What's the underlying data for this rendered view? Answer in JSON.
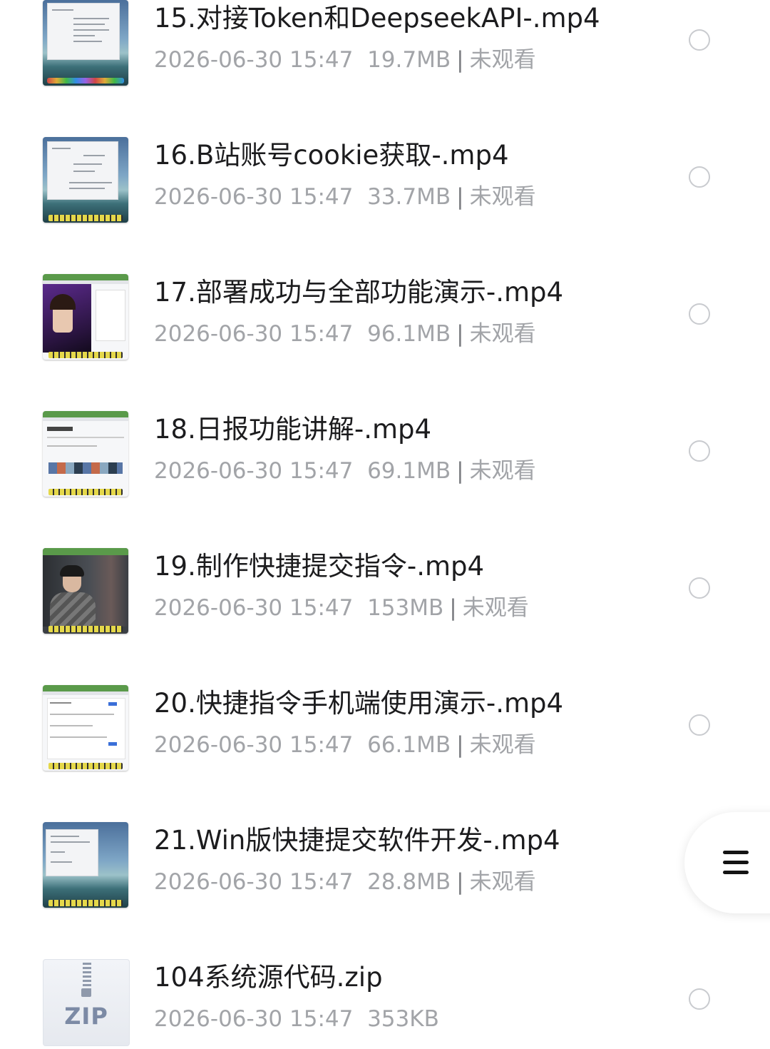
{
  "files": [
    {
      "name": "15.对接Token和DeepseekAPI-.mp4",
      "date": "2026-06-30 15:47",
      "size": "19.7MB",
      "status": "未观看",
      "thumb_icon": "video-thumbnail-icon"
    },
    {
      "name": "16.B站账号cookie获取-.mp4",
      "date": "2026-06-30 15:47",
      "size": "33.7MB",
      "status": "未观看",
      "thumb_icon": "video-thumbnail-icon"
    },
    {
      "name": "17.部署成功与全部功能演示-.mp4",
      "date": "2026-06-30 15:47",
      "size": "96.1MB",
      "status": "未观看",
      "thumb_icon": "video-thumbnail-icon"
    },
    {
      "name": "18.日报功能讲解-.mp4",
      "date": "2026-06-30 15:47",
      "size": "69.1MB",
      "status": "未观看",
      "thumb_icon": "video-thumbnail-icon"
    },
    {
      "name": "19.制作快捷提交指令-.mp4",
      "date": "2026-06-30 15:47",
      "size": "153MB",
      "status": "未观看",
      "thumb_icon": "video-thumbnail-icon"
    },
    {
      "name": "20.快捷指令手机端使用演示-.mp4",
      "date": "2026-06-30 15:47",
      "size": "66.1MB",
      "status": "未观看",
      "thumb_icon": "video-thumbnail-icon"
    },
    {
      "name": "21.Win版快捷提交软件开发-.mp4",
      "date": "2026-06-30 15:47",
      "size": "28.8MB",
      "status": "未观看",
      "thumb_icon": "video-thumbnail-icon"
    },
    {
      "name": "104系统源代码.zip",
      "date": "2026-06-30 15:47",
      "size": "353KB",
      "status": "",
      "thumb_icon": "zip-file-icon",
      "thumb_label": "ZIP"
    }
  ],
  "separator": "|",
  "floating_menu": {
    "icon": "hamburger-menu-icon"
  }
}
